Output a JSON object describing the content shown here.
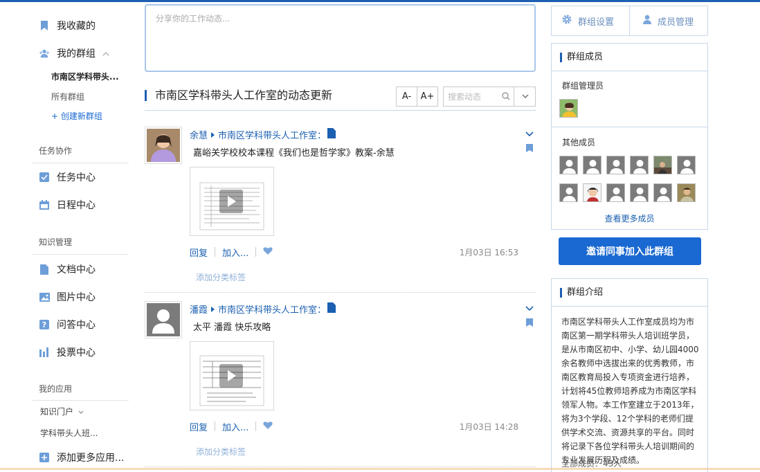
{
  "sidebar": {
    "favorites": "我收藏的",
    "my_groups": "我的群组",
    "groups": [
      {
        "label": "市南区学科带头..."
      },
      {
        "label": "所有群组"
      },
      {
        "label": "+ 创建新群组"
      }
    ],
    "task_section": "任务协作",
    "task_center": "任务中心",
    "schedule_center": "日程中心",
    "knowledge_section": "知识管理",
    "doc_center": "文档中心",
    "image_center": "图片中心",
    "qa_center": "问答中心",
    "vote_center": "投票中心",
    "apps_section": "我的应用",
    "portal": "知识门户",
    "leader_class": "学科带头人班...",
    "add_apps": "添加更多应用..."
  },
  "composer": {
    "placeholder": "分享你的工作动态..."
  },
  "feed": {
    "title": "市南区学科带头人工作室的动态更新",
    "font_smaller": "A-",
    "font_larger": "A+",
    "search_placeholder": "搜索动态",
    "posts": [
      {
        "author": "余慧",
        "group": "市南区学科带头人工作室",
        "text": "嘉峪关学校校本课程《我们也是哲学家》教案-余慧",
        "reply": "回复",
        "add": "加入...",
        "time": "1月03日 16:53",
        "tag": "添加分类标签"
      },
      {
        "author": "潘霞",
        "group": "市南区学科带头人工作室",
        "text": "太平 潘霞 快乐攻略",
        "reply": "回复",
        "add": "加入...",
        "time": "1月03日 14:28",
        "tag": "添加分类标签"
      }
    ]
  },
  "right": {
    "group_settings": "群组设置",
    "member_manage": "成员管理",
    "members_title": "群组成员",
    "admins_label": "群组管理员",
    "others_label": "其他成员",
    "more_members": "查看更多成员",
    "invite": "邀请同事加入此群组",
    "intro_title": "群组介绍",
    "intro_text": "市南区学科带头人工作室成员均为市南区第一期学科带头人培训班学员，是从市南区初中、小学、幼儿园4000余名教师中选拔出来的优秀教师，市南区教育局投入专项资金进行培养，计划将45位教师培养成为市南区学科领军人物。本工作室建立于2013年，将为3个学段、12个学科的老师们提供学术交流、资源共享的平台。同时将记录下各位学科带头人培训期间的专业发展历程及成绩。",
    "total_members": "全部成员：43人"
  },
  "colors": {
    "accent": "#1a68d1",
    "link": "#1a5fb0",
    "border": "#c6d7ea"
  }
}
